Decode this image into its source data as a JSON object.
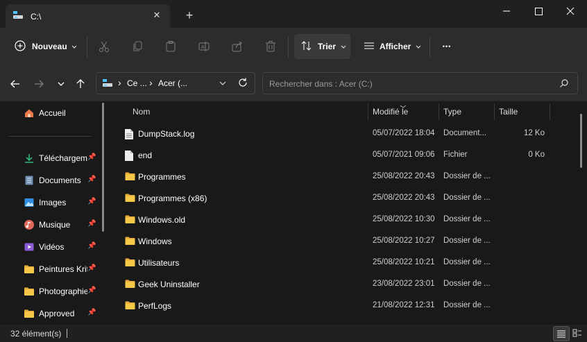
{
  "tab": {
    "title": "C:\\",
    "close_glyph": "✕"
  },
  "new_tab_glyph": "+",
  "toolbar": {
    "new_label": "Nouveau",
    "sort_label": "Trier",
    "view_label": "Afficher",
    "more_glyph": "•••"
  },
  "address": {
    "seg1": "Ce ...",
    "seg2": "Acer (...",
    "chev": "›"
  },
  "search": {
    "placeholder": "Rechercher dans : Acer (C:)"
  },
  "sidebar": {
    "home": "Accueil",
    "items": [
      {
        "label": "Téléchargements",
        "icon": "download-icon"
      },
      {
        "label": "Documents",
        "icon": "documents-icon"
      },
      {
        "label": "Images",
        "icon": "images-icon"
      },
      {
        "label": "Musique",
        "icon": "music-icon"
      },
      {
        "label": "Vidéos",
        "icon": "videos-icon"
      },
      {
        "label": "Peintures Krita",
        "icon": "folder-icon"
      },
      {
        "label": "Photographie",
        "icon": "folder-icon"
      },
      {
        "label": "Approved",
        "icon": "folder-icon"
      }
    ]
  },
  "columns": {
    "name": "Nom",
    "modified": "Modifié le",
    "type": "Type",
    "size": "Taille"
  },
  "rows": [
    {
      "name": "DumpStack.log",
      "date": "05/07/2022 18:04",
      "type": "Document...",
      "size": "12 Ko",
      "icon": "file-text-icon"
    },
    {
      "name": "end",
      "date": "05/07/2021 09:06",
      "type": "Fichier",
      "size": "0 Ko",
      "icon": "file-icon"
    },
    {
      "name": "Programmes",
      "date": "25/08/2022 20:43",
      "type": "Dossier de ...",
      "size": "",
      "icon": "folder-icon"
    },
    {
      "name": "Programmes (x86)",
      "date": "25/08/2022 20:43",
      "type": "Dossier de ...",
      "size": "",
      "icon": "folder-icon"
    },
    {
      "name": "Windows.old",
      "date": "25/08/2022 10:30",
      "type": "Dossier de ...",
      "size": "",
      "icon": "folder-icon"
    },
    {
      "name": "Windows",
      "date": "25/08/2022 10:27",
      "type": "Dossier de ...",
      "size": "",
      "icon": "folder-icon"
    },
    {
      "name": "Utilisateurs",
      "date": "25/08/2022 10:21",
      "type": "Dossier de ...",
      "size": "",
      "icon": "folder-icon"
    },
    {
      "name": "Geek Uninstaller",
      "date": "23/08/2022 23:01",
      "type": "Dossier de ...",
      "size": "",
      "icon": "folder-icon"
    },
    {
      "name": "PerfLogs",
      "date": "21/08/2022 12:31",
      "type": "Dossier de ...",
      "size": "",
      "icon": "folder-icon"
    }
  ],
  "status": {
    "count": "32 élément(s)"
  },
  "colors": {
    "bg": "#191919",
    "toolbar": "#2c2c2c",
    "folder": "#f2c14e",
    "accent": "#4cc2ff"
  }
}
